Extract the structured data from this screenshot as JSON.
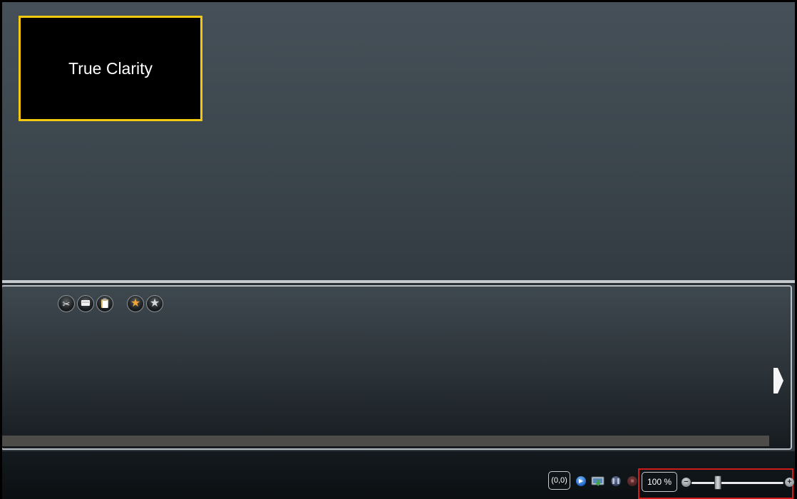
{
  "preview": {
    "clip_title": "True Clarity",
    "clip_border_color": "#f2c811"
  },
  "timeline": {
    "toolbar_icons": [
      "scissors-icon",
      "copy-icon",
      "paste-icon",
      "favorite-gold-star-icon",
      "favorite-silver-star-icon"
    ],
    "next_arrow_icon": "right-arrow-icon"
  },
  "bottom_bar": {
    "coordinates": "(0,0)",
    "zoom_value": "100 %",
    "zoom_level": 0.27,
    "zoom_out_icon": "minus-icon",
    "zoom_in_icon": "plus-icon",
    "highlight_color": "#d11a1a"
  }
}
